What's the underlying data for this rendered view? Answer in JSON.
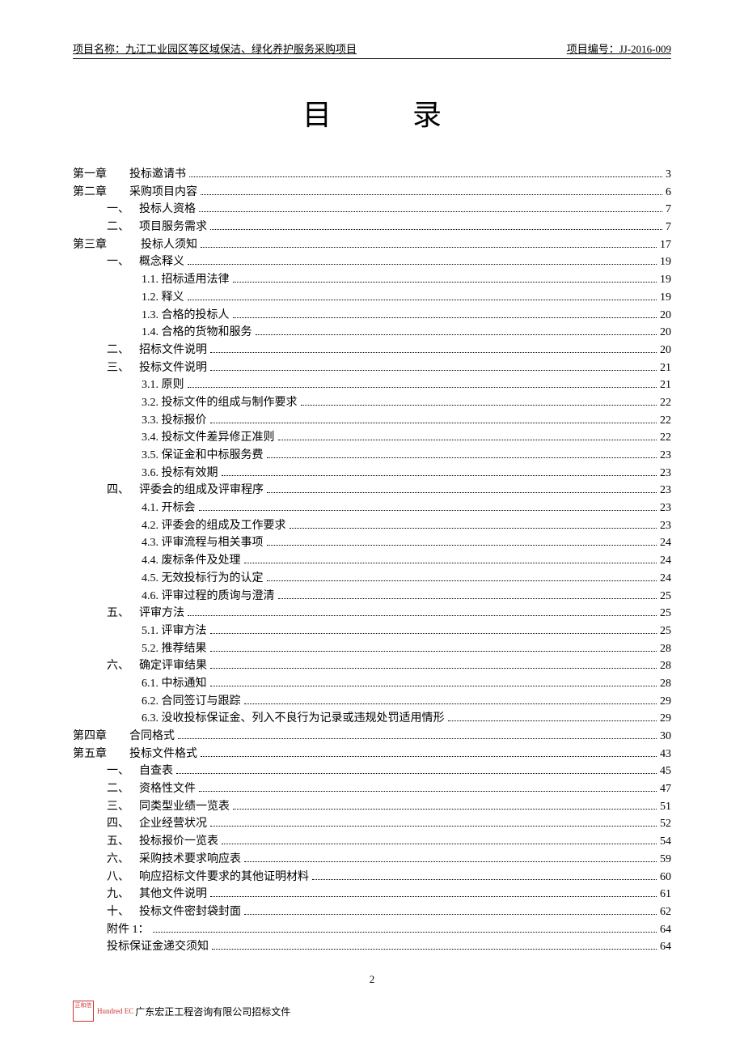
{
  "header": {
    "project_name_label": "项目名称：",
    "project_name": "九江工业园区等区域保洁、绿化养护服务采购项目",
    "project_code_label": "项目编号：",
    "project_code": "JJ-2016-009"
  },
  "title": "目录",
  "toc": [
    {
      "indent": 0,
      "chapter": "第一章",
      "label": "投标邀请书",
      "page": "3"
    },
    {
      "indent": 0,
      "chapter": "第二章",
      "label": "采购项目内容",
      "page": "6"
    },
    {
      "indent": 1,
      "section": "一、",
      "label": "投标人资格",
      "page": "7"
    },
    {
      "indent": 1,
      "section": "二、",
      "label": "项目服务需求",
      "page": "7"
    },
    {
      "indent": 0,
      "chapter": "第三章",
      "label": "投标人须知",
      "extraPad": true,
      "page": "17"
    },
    {
      "indent": 1,
      "section": "一、",
      "label": "概念释义",
      "page": "19"
    },
    {
      "indent": 2,
      "num": "1.1.",
      "label": "招标适用法律",
      "page": "19"
    },
    {
      "indent": 2,
      "num": "1.2.",
      "label": "释义",
      "page": "19"
    },
    {
      "indent": 2,
      "num": "1.3.",
      "label": "合格的投标人",
      "page": "20"
    },
    {
      "indent": 2,
      "num": "1.4.",
      "label": "合格的货物和服务",
      "page": "20"
    },
    {
      "indent": 1,
      "section": "二、",
      "label": "招标文件说明",
      "page": "20"
    },
    {
      "indent": 1,
      "section": "三、",
      "label": "投标文件说明",
      "page": "21"
    },
    {
      "indent": 2,
      "num": "3.1.",
      "label": "原则",
      "page": "21"
    },
    {
      "indent": 2,
      "num": "3.2.",
      "label": "投标文件的组成与制作要求",
      "page": "22"
    },
    {
      "indent": 2,
      "num": "3.3.",
      "label": "投标报价",
      "page": "22"
    },
    {
      "indent": 2,
      "num": "3.4.",
      "label": "投标文件差异修正准则",
      "page": "22"
    },
    {
      "indent": 2,
      "num": "3.5.",
      "label": "保证金和中标服务费",
      "page": "23"
    },
    {
      "indent": 2,
      "num": "3.6.",
      "label": "投标有效期",
      "page": "23"
    },
    {
      "indent": 1,
      "section": "四、",
      "label": "评委会的组成及评审程序",
      "page": "23"
    },
    {
      "indent": 2,
      "num": "4.1.",
      "label": "开标会",
      "page": "23"
    },
    {
      "indent": 2,
      "num": "4.2.",
      "label": "评委会的组成及工作要求",
      "page": "23"
    },
    {
      "indent": 2,
      "num": "4.3.",
      "label": "评审流程与相关事项",
      "page": "24"
    },
    {
      "indent": 2,
      "num": "4.4.",
      "label": "废标条件及处理",
      "page": "24"
    },
    {
      "indent": 2,
      "num": "4.5.",
      "label": "无效投标行为的认定",
      "page": "24"
    },
    {
      "indent": 2,
      "num": "4.6.",
      "label": "评审过程的质询与澄清",
      "page": "25"
    },
    {
      "indent": 1,
      "section": "五、",
      "label": "评审方法",
      "page": "25"
    },
    {
      "indent": 2,
      "num": "5.1.",
      "label": "评审方法",
      "page": "25"
    },
    {
      "indent": 2,
      "num": "5.2.",
      "label": "推荐结果",
      "page": "28"
    },
    {
      "indent": 1,
      "section": "六、",
      "label": "确定评审结果",
      "page": "28"
    },
    {
      "indent": 2,
      "num": "6.1.",
      "label": "中标通知",
      "page": "28"
    },
    {
      "indent": 2,
      "num": "6.2.",
      "label": "合同签订与跟踪",
      "page": "29"
    },
    {
      "indent": 2,
      "num": "6.3.",
      "label": "没收投标保证金、列入不良行为记录或违规处罚适用情形",
      "page": "29"
    },
    {
      "indent": 0,
      "chapter": "第四章",
      "label": "合同格式",
      "page": "30"
    },
    {
      "indent": 0,
      "chapter": "第五章",
      "label": "投标文件格式",
      "page": "43"
    },
    {
      "indent": 1,
      "section": "一、",
      "label": "自查表",
      "page": "45"
    },
    {
      "indent": 1,
      "section": "二、",
      "label": "资格性文件",
      "page": "47"
    },
    {
      "indent": 1,
      "section": "三、",
      "label": "同类型业绩一览表",
      "page": "51"
    },
    {
      "indent": 1,
      "section": "四、",
      "label": "企业经营状况",
      "page": "52"
    },
    {
      "indent": 1,
      "section": "五、",
      "label": "投标报价一览表",
      "page": "54"
    },
    {
      "indent": 1,
      "section": "六、",
      "label": "采购技术要求响应表",
      "page": "59"
    },
    {
      "indent": 1,
      "section": "八、",
      "label": "响应招标文件要求的其他证明材料",
      "page": "60"
    },
    {
      "indent": 1,
      "section": "九、",
      "label": "其他文件说明",
      "page": "61"
    },
    {
      "indent": 1,
      "section": "十、",
      "label": "投标文件密封袋封面",
      "page": "62"
    },
    {
      "indent": 1,
      "text": "附件 1：",
      "page": "64"
    },
    {
      "indent": 1,
      "text": "投标保证金递交须知",
      "page": "64"
    }
  ],
  "footer": {
    "page_number": "2",
    "stamp_text": "正和信",
    "hundred": "Hundred EC",
    "company": "广东宏正工程咨询有限公司招标文件"
  }
}
